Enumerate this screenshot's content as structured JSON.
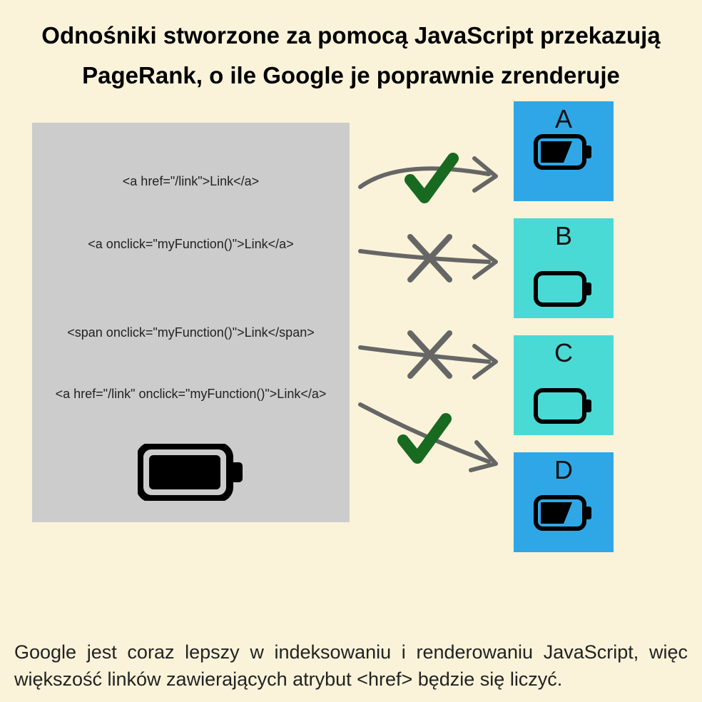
{
  "title": "Odnośniki stworzone za pomocą JavaScript przekazują PageRank, o ile Google je poprawnie zrenderuje",
  "codes": {
    "c1": "<a href=\"/link\">Link</a>",
    "c2": "<a onclick=\"myFunction()\">Link</a>",
    "c3": "<span onclick=\"myFunction()\">Link</span>",
    "c4": "<a href=\"/link\" onclick=\"myFunction()\">Link</a>"
  },
  "targets": {
    "a": "A",
    "b": "B",
    "c": "C",
    "d": "D"
  },
  "arrows": [
    {
      "code": "c1",
      "target": "A",
      "passes": true
    },
    {
      "code": "c2",
      "target": "B",
      "passes": false
    },
    {
      "code": "c3",
      "target": "C",
      "passes": false
    },
    {
      "code": "c4",
      "target": "D",
      "passes": true
    }
  ],
  "footer": "Google jest coraz lepszy w indeksowaniu i renderowaniu JavaScript, więc większość linków zawierających atrybut <href> będzie się liczyć."
}
